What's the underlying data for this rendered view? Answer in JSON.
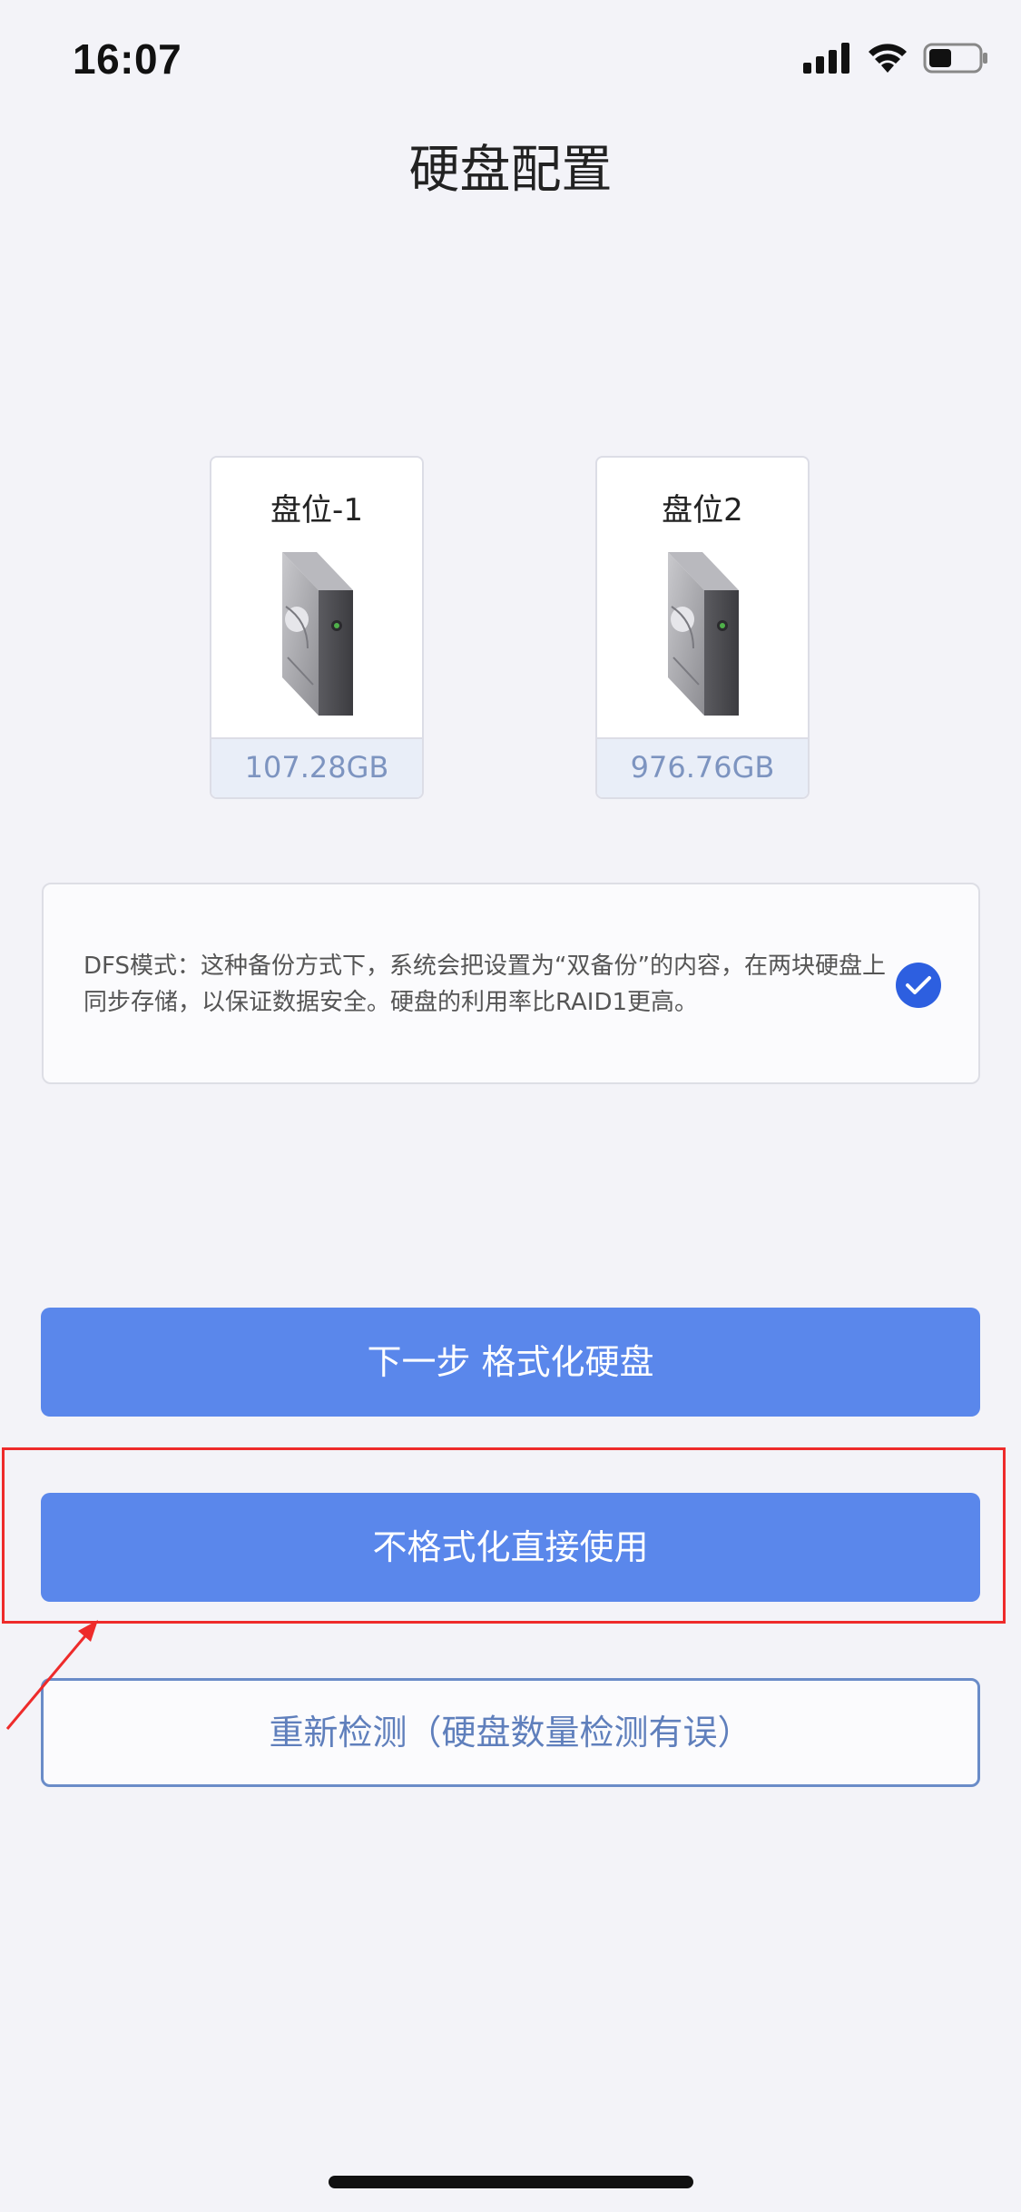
{
  "status_bar": {
    "time": "16:07",
    "icons": [
      "signal-icon",
      "wifi-icon",
      "battery-icon"
    ]
  },
  "header": {
    "title": "硬盘配置"
  },
  "disks": [
    {
      "label": "盘位-1",
      "size": "107.28GB",
      "icon": "hard-drive-icon"
    },
    {
      "label": "盘位2",
      "size": "976.76GB",
      "icon": "hard-drive-icon"
    }
  ],
  "dfs_mode": {
    "text": "DFS模式：这种备份方式下，系统会把设置为“双备份”的内容，在两块硬盘上同步存储，以保证数据安全。硬盘的利用率比RAID1更高。",
    "selected": true
  },
  "buttons": {
    "next": "下一步 格式化硬盘",
    "direct_use": "不格式化直接使用",
    "recheck": "重新检测（硬盘数量检测有误）"
  },
  "colors": {
    "primary": "#5a87eb",
    "check": "#2d5fe0",
    "annotation": "#ee2b2b"
  }
}
